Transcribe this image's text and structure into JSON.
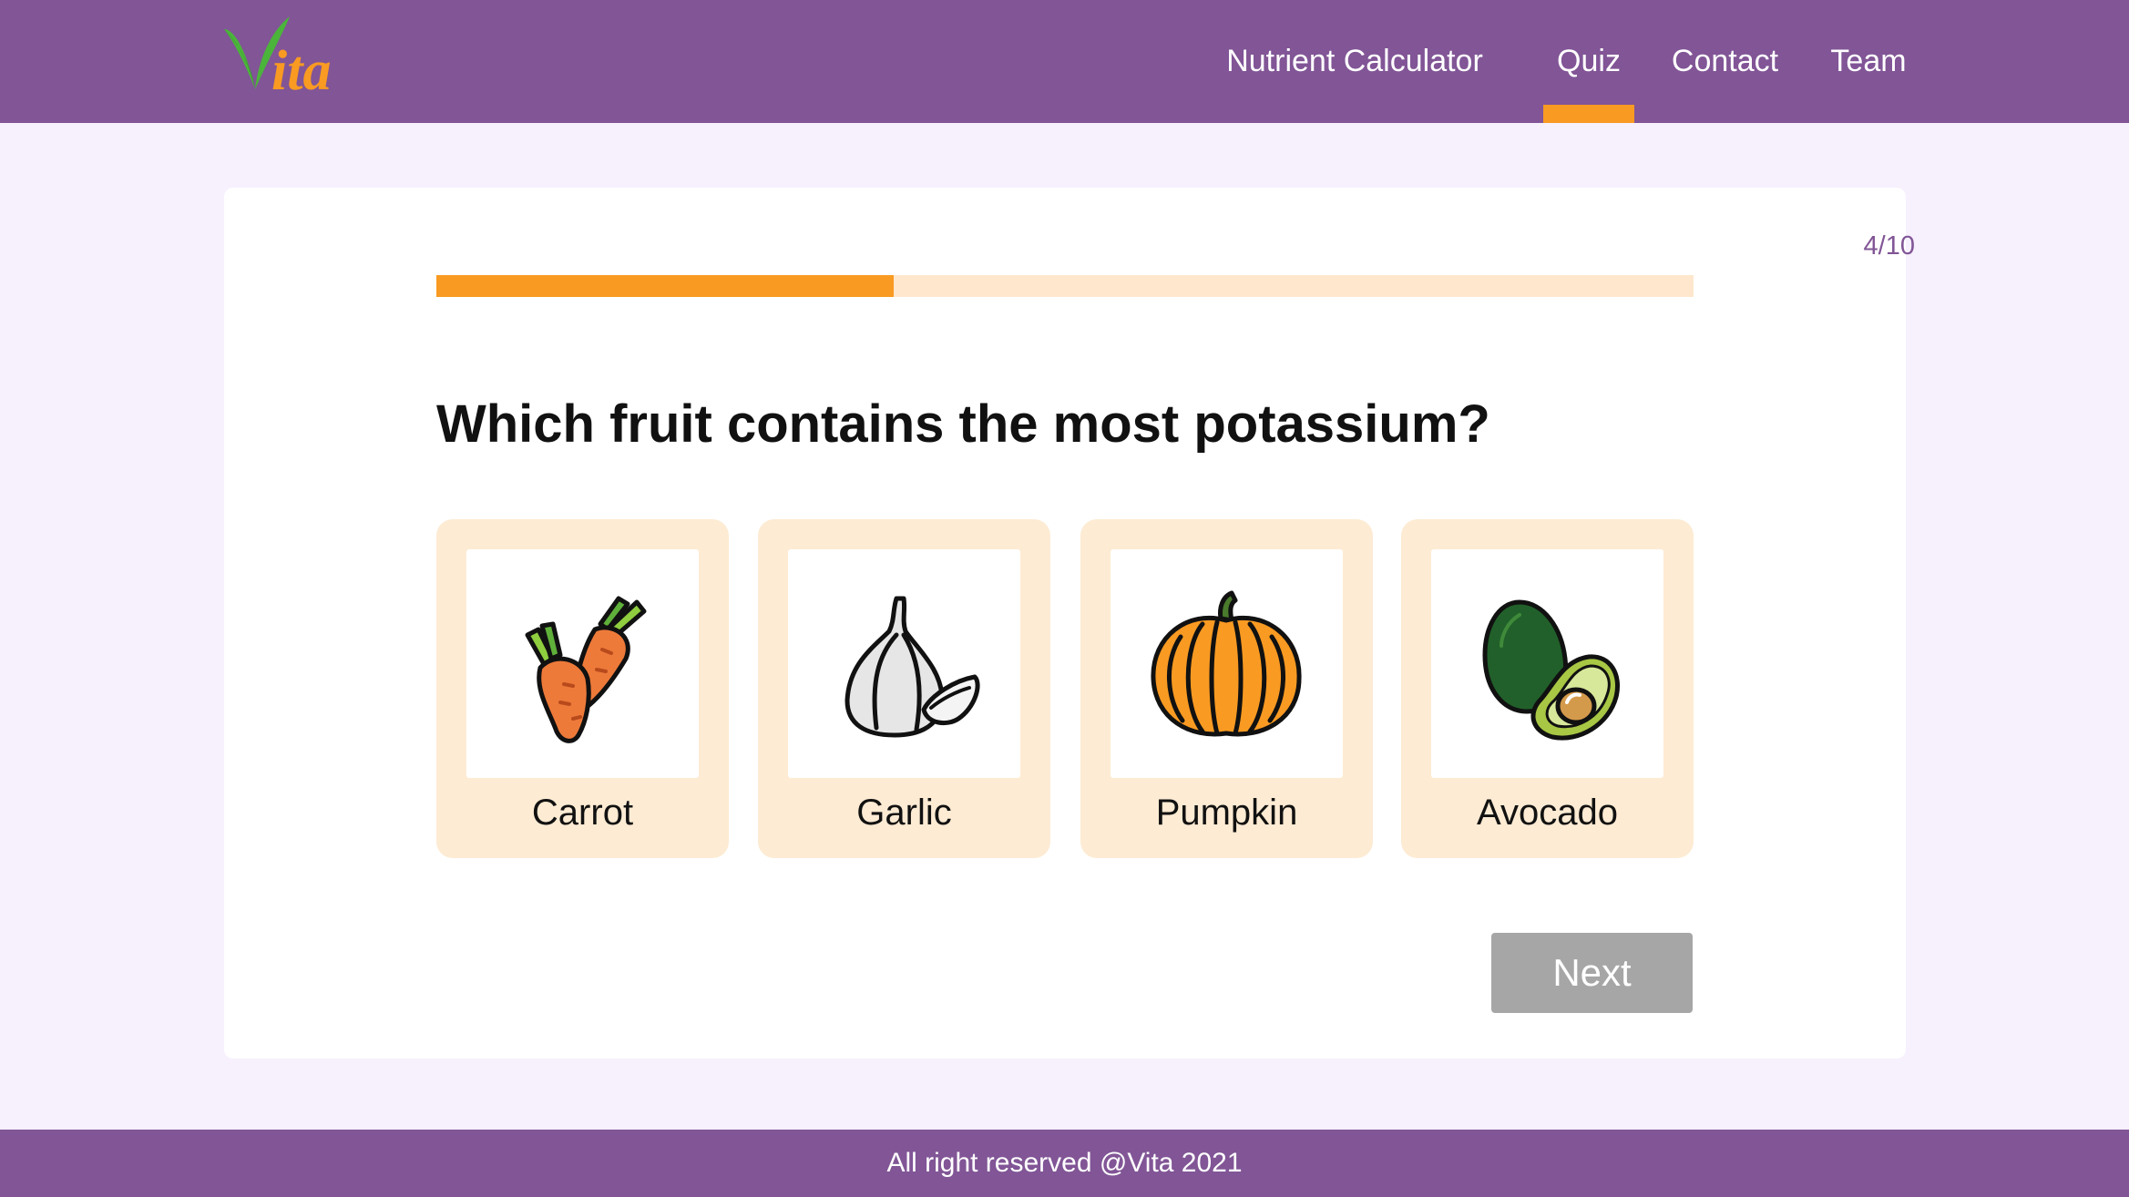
{
  "header": {
    "logo_text": "Vita",
    "nav": [
      {
        "label": "Nutrient Calculator",
        "active": false
      },
      {
        "label": "Quiz",
        "active": true
      },
      {
        "label": "Contact",
        "active": false
      },
      {
        "label": "Team",
        "active": false
      }
    ]
  },
  "quiz": {
    "progress_label": "4/10",
    "progress_fraction": 0.364,
    "question": "Which fruit contains the most potassium?",
    "options": [
      {
        "label": "Carrot",
        "icon": "carrot-icon"
      },
      {
        "label": "Garlic",
        "icon": "garlic-icon"
      },
      {
        "label": "Pumpkin",
        "icon": "pumpkin-icon"
      },
      {
        "label": "Avocado",
        "icon": "avocado-icon"
      }
    ],
    "next_label": "Next"
  },
  "footer": {
    "text": "All right reserved @Vita 2021"
  },
  "colors": {
    "brand_purple": "#815596",
    "accent_orange": "#f99a22",
    "option_bg": "#fdebd3",
    "progress_track": "#fee7cd",
    "button_disabled": "#a6a6a6",
    "page_bg": "#f7f0fd"
  }
}
